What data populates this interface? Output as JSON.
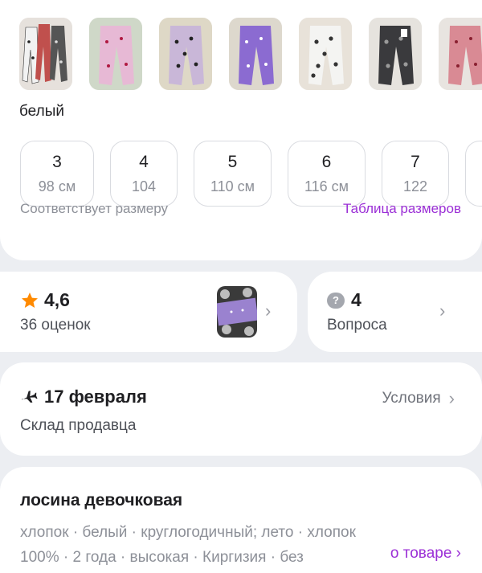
{
  "colors": {
    "accent": "#9b2fd6",
    "star": "#ff8a00",
    "muted": "#8d9098"
  },
  "color_variant": {
    "selected_label": "белый",
    "thumbnails": [
      {
        "name": "variant-mix"
      },
      {
        "name": "variant-pink-hearts"
      },
      {
        "name": "variant-beige-hearts"
      },
      {
        "name": "variant-purple-unicorn"
      },
      {
        "name": "variant-white-leopard"
      },
      {
        "name": "variant-dark-leopard"
      },
      {
        "name": "variant-pink-pattern"
      }
    ]
  },
  "sizes": [
    {
      "size": "3",
      "height": "98 см"
    },
    {
      "size": "4",
      "height": "104"
    },
    {
      "size": "5",
      "height": "110 см"
    },
    {
      "size": "6",
      "height": "116 см"
    },
    {
      "size": "7",
      "height": "122"
    }
  ],
  "fit_text": "Соответствует размеру",
  "size_table_link": "Таблица размеров",
  "rating": {
    "value": "4,6",
    "count": "36 оценок",
    "icon": "star-icon"
  },
  "questions": {
    "count": "4",
    "label": "Вопроса",
    "icon": "question-bubble-icon"
  },
  "delivery": {
    "date": "17 февраля",
    "source": "Склад продавца",
    "conditions_label": "Условия",
    "icon": "airplane-icon"
  },
  "product": {
    "title": "лосина девочковая",
    "attributes": "хлопок · белый · круглогодичный; лето · хлопок 100% · 2 года · высокая · Киргизия · без",
    "about_link": "о товаре ›"
  }
}
